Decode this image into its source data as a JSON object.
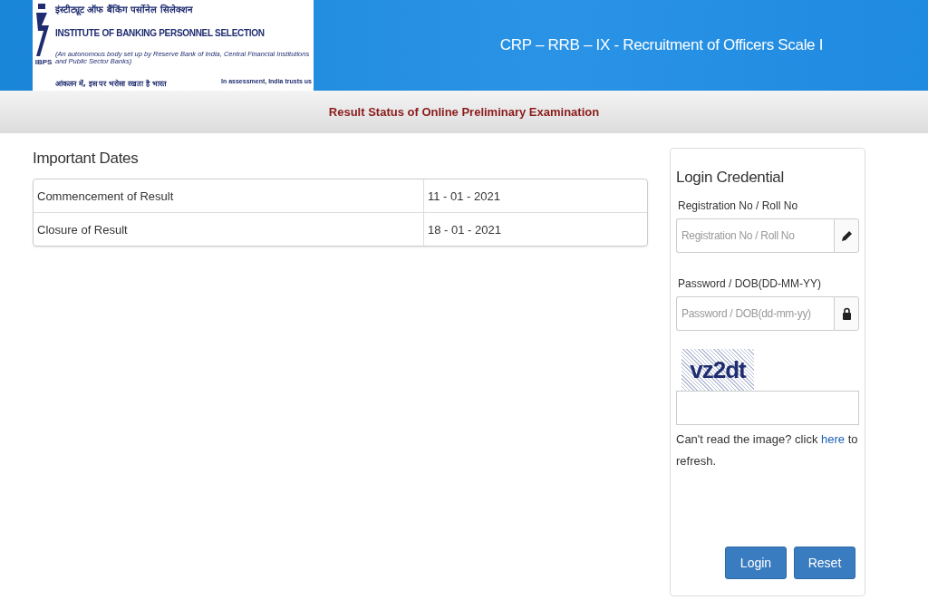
{
  "header": {
    "logo": {
      "mark": "IBPS",
      "hindi_title": "इंस्टीट्यूट ऑफ बैंकिंग पर्सोनेल सिलेक्शन",
      "english_title": "INSTITUTE OF BANKING PERSONNEL SELECTION",
      "subtitle": "(An autonomous body set up by Reserve Bank of India, Central Financial Institutions and Public Sector Banks)",
      "hindi_tagline": "आंकलन में, इस पर भरोसा रखता है भारत",
      "tagline": "In assessment, India trusts us"
    },
    "title": "CRP – RRB – IX - Recruitment of Officers Scale I"
  },
  "subheader": "Result Status of Online Preliminary Examination",
  "important_dates": {
    "heading": "Important Dates",
    "rows": [
      {
        "label": "Commencement of Result",
        "date": "11 - 01 - 2021"
      },
      {
        "label": "Closure of Result",
        "date": "18 - 01 - 2021"
      }
    ]
  },
  "login": {
    "heading": "Login Credential",
    "fields": [
      {
        "label": "Registration No / Roll No",
        "placeholder": "Registration No / Roll No",
        "kind": "pencil"
      },
      {
        "label": "Password / DOB(DD-MM-YY)",
        "placeholder": "Password / DOB(dd-mm-yy)",
        "kind": "lock"
      }
    ],
    "captcha": "vz2dt",
    "help_before": "Can't read the image? click",
    "help_link": "here",
    "help_after": "to refresh.",
    "buttons": [
      "Login",
      "Reset"
    ]
  }
}
